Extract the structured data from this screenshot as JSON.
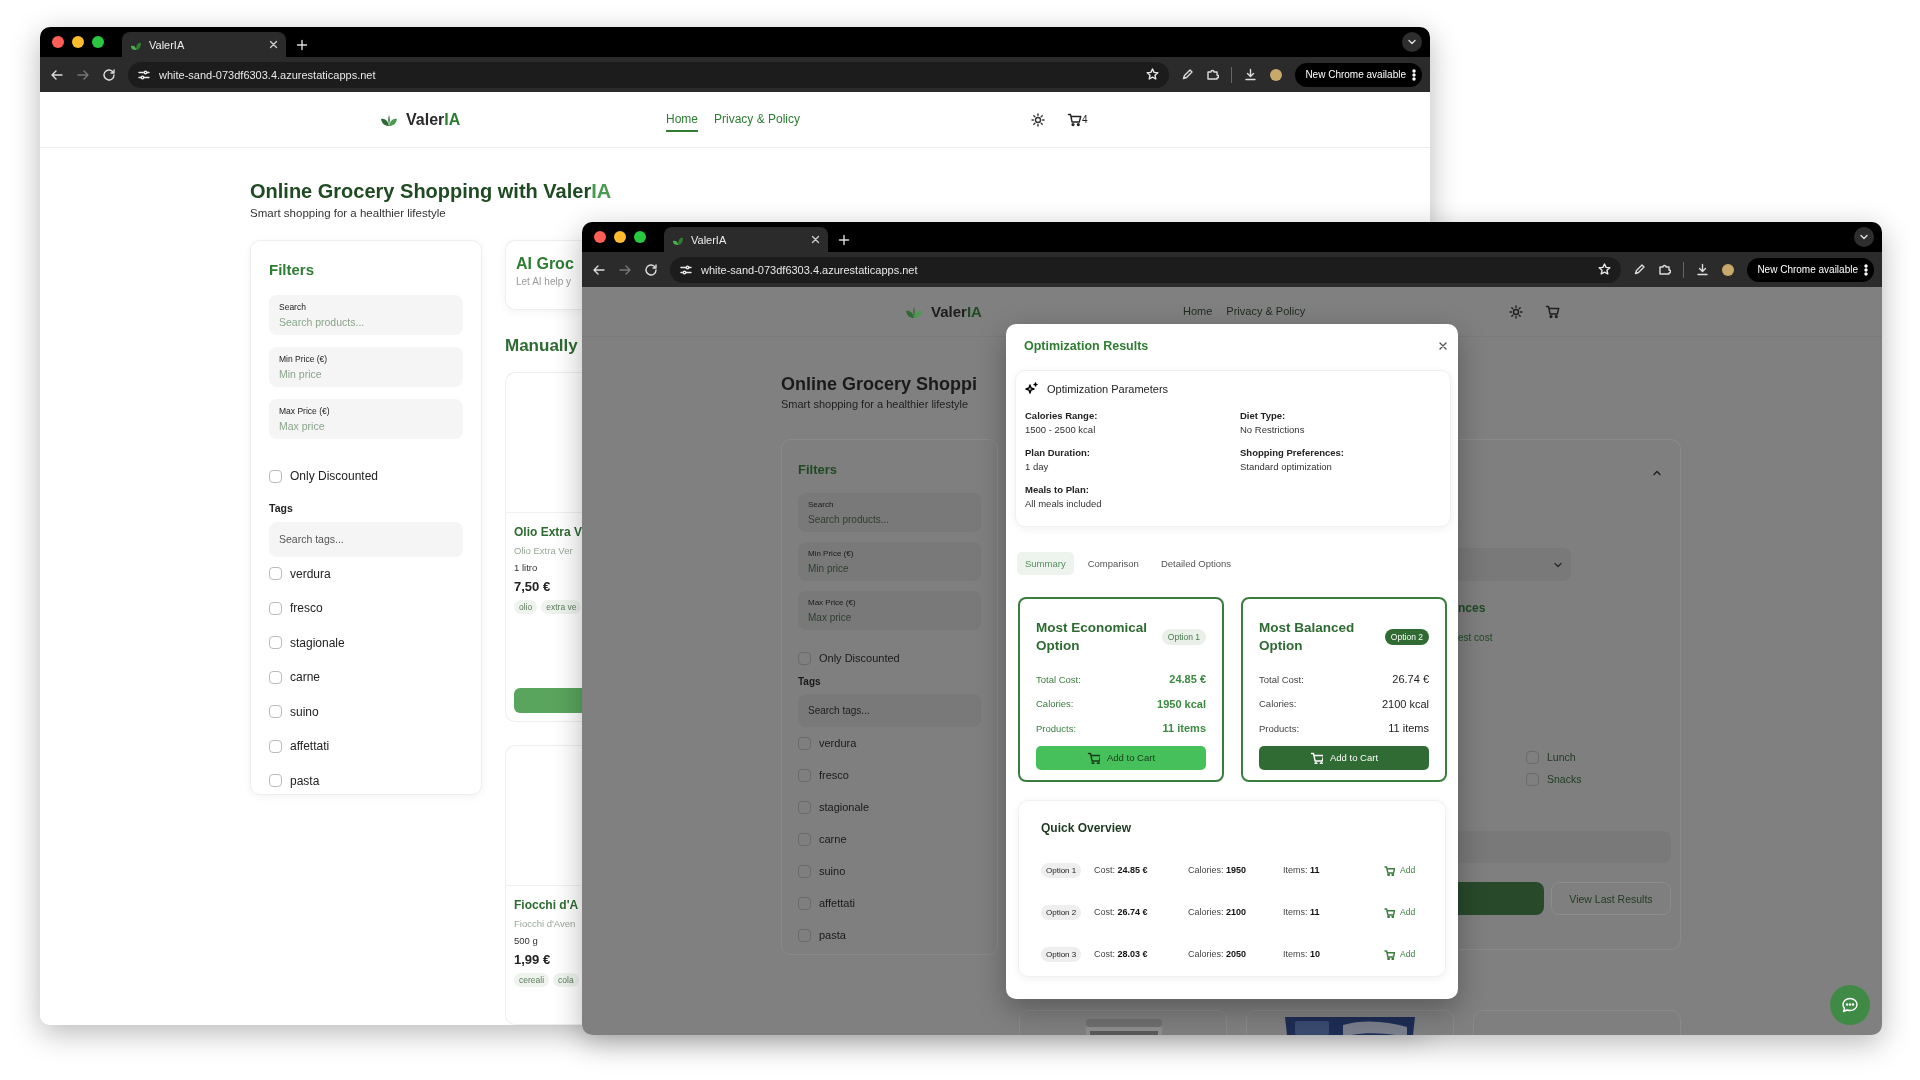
{
  "back_window": {
    "tab": {
      "title": "ValerIA"
    },
    "address": "white-sand-073df6303.4.azurestaticapps.net",
    "update_button": "New Chrome available",
    "nav": {
      "logo": "Valer**IA**",
      "links": [
        {
          "label": "Home",
          "selected": true
        },
        {
          "label": "Privacy & Policy",
          "selected": false
        }
      ],
      "cart_count": "4"
    },
    "heading": "Online Grocery Shopping with Valer**IA**",
    "subtitle": "Smart shopping for a healthier lifestyle",
    "filters": {
      "title": "Filters",
      "fields": [
        {
          "label": "Search",
          "placeholder": "Search products..."
        },
        {
          "label": "Min Price (€)",
          "placeholder": "Min price"
        },
        {
          "label": "Max Price (€)",
          "placeholder": "Max price"
        }
      ],
      "discount": {
        "label": "Only Discounted",
        "checked": false
      },
      "tags_label": "Tags",
      "tag_search": {
        "placeholder": "Search tags..."
      },
      "tags": [
        {
          "label": "verdura",
          "checked": false
        },
        {
          "label": "fresco",
          "checked": false
        },
        {
          "label": "stagionale",
          "checked": false
        },
        {
          "label": "carne",
          "checked": false
        },
        {
          "label": "suino",
          "checked": false
        },
        {
          "label": "affettati",
          "checked": false
        },
        {
          "label": "pasta",
          "checked": false
        }
      ]
    },
    "ai_card": {
      "title": "AI Groc",
      "subtitle": "Let AI help y"
    },
    "section_title": "Manually",
    "products": [
      {
        "name": "Olio Extra V",
        "description": "Olio Extra Ver",
        "size": "1 litro",
        "price": "7,50 €",
        "tags": [
          "olio",
          "extra ve"
        ]
      },
      {
        "name": "Fiocchi d'A",
        "description": "Fiocchi d'Aven",
        "size": "500 g",
        "price": "1,99 €",
        "tags": [
          "cereali",
          "cola"
        ]
      }
    ]
  },
  "front_window": {
    "tab": {
      "title": "ValerIA"
    },
    "address": "white-sand-073df6303.4.azurestaticapps.net",
    "update_button": "New Chrome available",
    "nav": {
      "logo": "Valer**IA**",
      "links": [
        {
          "label": "Home",
          "selected": false
        },
        {
          "label": "Privacy & Policy",
          "selected": false
        }
      ]
    },
    "heading": "Online Grocery Shoppi",
    "subtitle": "Smart shopping for a healthier lifestyle",
    "filters": {
      "title": "Filters",
      "fields": [
        {
          "label": "Search",
          "placeholder": "Search products..."
        },
        {
          "label": "Min Price (€)",
          "placeholder": "Min price"
        },
        {
          "label": "Max Price (€)",
          "placeholder": "Max price"
        }
      ],
      "discount": {
        "label": "Only Discounted",
        "checked": false
      },
      "tags_label": "Tags",
      "tag_search": {
        "placeholder": "Search tags..."
      },
      "tags": [
        {
          "label": "verdura",
          "checked": false
        },
        {
          "label": "fresco",
          "checked": false
        },
        {
          "label": "stagionale",
          "checked": false
        },
        {
          "label": "carne",
          "checked": false
        },
        {
          "label": "suino",
          "checked": false
        },
        {
          "label": "affettati",
          "checked": false
        },
        {
          "label": "pasta",
          "checked": false
        }
      ]
    },
    "side_panel": {
      "heading_fragment": "nces",
      "text_fragment": "est cost",
      "meals": [
        {
          "label": "Lunch",
          "checked": false
        },
        {
          "label": "Snacks",
          "checked": false
        }
      ],
      "results_button": "View Last Results"
    },
    "modal": {
      "title": "Optimization Results",
      "parameters": {
        "title": "Optimization Parameters",
        "items": [
          {
            "label": "Calories Range:",
            "value": "1500 - 2500 kcal"
          },
          {
            "label": "Diet Type:",
            "value": "No Restrictions"
          },
          {
            "label": "Plan Duration:",
            "value": "1 day"
          },
          {
            "label": "Shopping Preferences:",
            "value": "Standard optimization"
          },
          {
            "label": "Meals to Plan:",
            "value": "All meals included"
          }
        ]
      },
      "tabs": [
        {
          "label": "Summary",
          "selected": true
        },
        {
          "label": "Comparison",
          "selected": false
        },
        {
          "label": "Detailed Options",
          "selected": false
        }
      ],
      "options": [
        {
          "kind": "economical",
          "title": "Most Economical Option",
          "badge": "Option 1",
          "rows": [
            {
              "label": "Total Cost:",
              "value": "24.85 €"
            },
            {
              "label": "Calories:",
              "value": "1950 kcal"
            },
            {
              "label": "Products:",
              "value": "11 items"
            }
          ],
          "button": "Add to Cart"
        },
        {
          "kind": "balanced",
          "title": "Most Balanced Option",
          "badge": "Option 2",
          "rows": [
            {
              "label": "Total Cost:",
              "value": "26.74 €"
            },
            {
              "label": "Calories:",
              "value": "2100 kcal"
            },
            {
              "label": "Products:",
              "value": "11 items"
            }
          ],
          "button": "Add to Cart"
        }
      ],
      "overview": {
        "title": "Quick Overview",
        "rows": [
          {
            "badge": "Option 1",
            "cost": "Cost: **24.85 €**",
            "calories": "Calories: **1950**",
            "items": "Items: **11**",
            "action": "Add"
          },
          {
            "badge": "Option 2",
            "cost": "Cost: **26.74 €**",
            "calories": "Calories: **2100**",
            "items": "Items: **11**",
            "action": "Add"
          },
          {
            "badge": "Option 3",
            "cost": "Cost: **28.03 €**",
            "calories": "Calories: **2050**",
            "items": "Items: **10**",
            "action": "Add"
          }
        ]
      }
    }
  }
}
